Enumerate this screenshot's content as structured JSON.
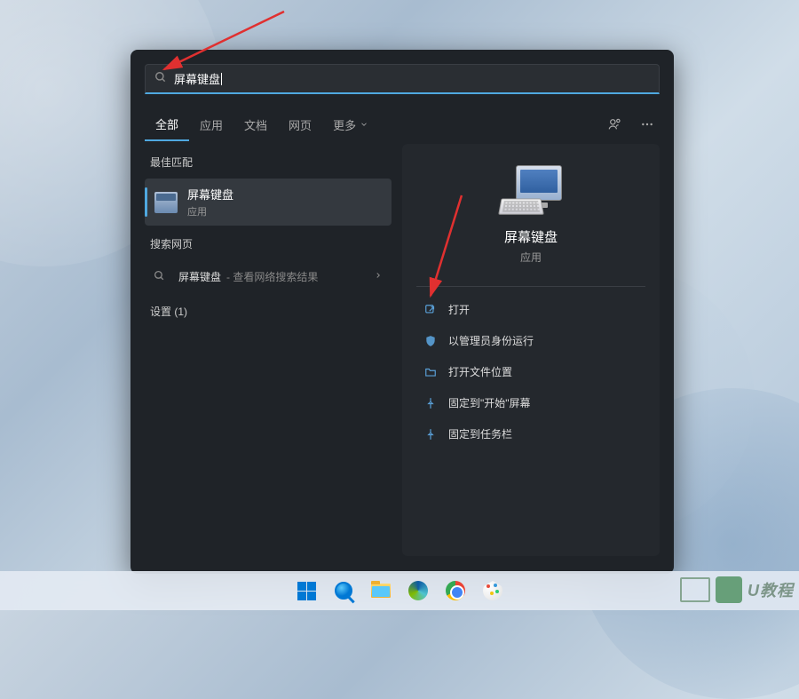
{
  "search": {
    "query": "屏幕键盘"
  },
  "tabs": {
    "items": [
      "全部",
      "应用",
      "文档",
      "网页"
    ],
    "more_label": "更多",
    "active_index": 0
  },
  "left": {
    "best_match_header": "最佳匹配",
    "best_match": {
      "title": "屏幕键盘",
      "subtitle": "应用"
    },
    "web_header": "搜索网页",
    "web_item": {
      "query": "屏幕键盘",
      "suffix": "- 查看网络搜索结果"
    },
    "settings_header": "设置 (1)"
  },
  "right": {
    "title": "屏幕键盘",
    "subtitle": "应用",
    "actions": [
      {
        "icon": "open",
        "label": "打开"
      },
      {
        "icon": "admin",
        "label": "以管理员身份运行"
      },
      {
        "icon": "folder",
        "label": "打开文件位置"
      },
      {
        "icon": "pin",
        "label": "固定到\"开始\"屏幕"
      },
      {
        "icon": "pin",
        "label": "固定到任务栏"
      }
    ]
  },
  "watermark": {
    "text": "U教程"
  }
}
